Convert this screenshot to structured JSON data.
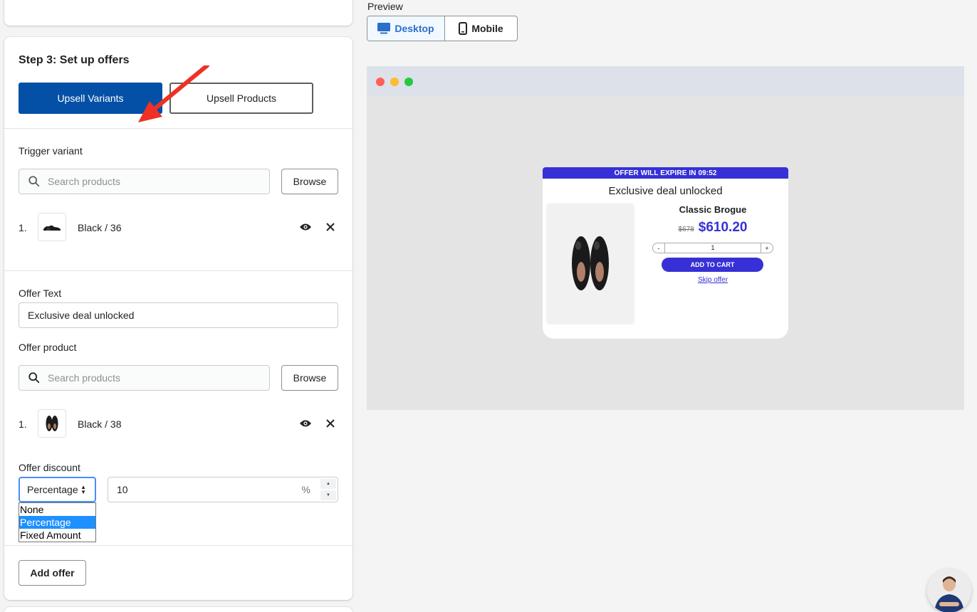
{
  "left_panel": {
    "step_title": "Step 3: Set up offers",
    "upsell_variants_label": "Upsell Variants",
    "upsell_products_label": "Upsell Products",
    "trigger": {
      "label": "Trigger variant",
      "search_placeholder": "Search products",
      "browse_label": "Browse",
      "items": [
        {
          "num": "1.",
          "name": "Black / 36",
          "thumb_icon": "shoe-side-icon"
        }
      ]
    },
    "offer_text": {
      "label": "Offer Text",
      "value": "Exclusive deal unlocked"
    },
    "offer_product": {
      "label": "Offer product",
      "search_placeholder": "Search products",
      "browse_label": "Browse",
      "items": [
        {
          "num": "1.",
          "name": "Black / 38",
          "thumb_icon": "shoe-pair-icon"
        }
      ]
    },
    "offer_discount": {
      "label": "Offer discount",
      "type_value": "Percentage",
      "options": [
        "None",
        "Percentage",
        "Fixed Amount"
      ],
      "amount": "10",
      "suffix": "%"
    },
    "add_offer_label": "Add offer"
  },
  "preview": {
    "label": "Preview",
    "tabs": [
      {
        "label": "Desktop",
        "icon": "desktop-icon",
        "active": true
      },
      {
        "label": "Mobile",
        "icon": "mobile-icon",
        "active": false
      }
    ],
    "popup": {
      "banner": "OFFER WILL EXPIRE IN 09:52",
      "title": "Exclusive deal unlocked",
      "product_name": "Classic Brogue",
      "old_price": "$678",
      "new_price": "$610.20",
      "qty_minus": "-",
      "qty_value": "1",
      "qty_plus": "+",
      "add_to_cart": "ADD TO CART",
      "skip": "Skip offer"
    }
  },
  "colors": {
    "primary": "#0550a7",
    "popup_accent": "#3730d6",
    "annotation_arrow": "#ee3124"
  }
}
